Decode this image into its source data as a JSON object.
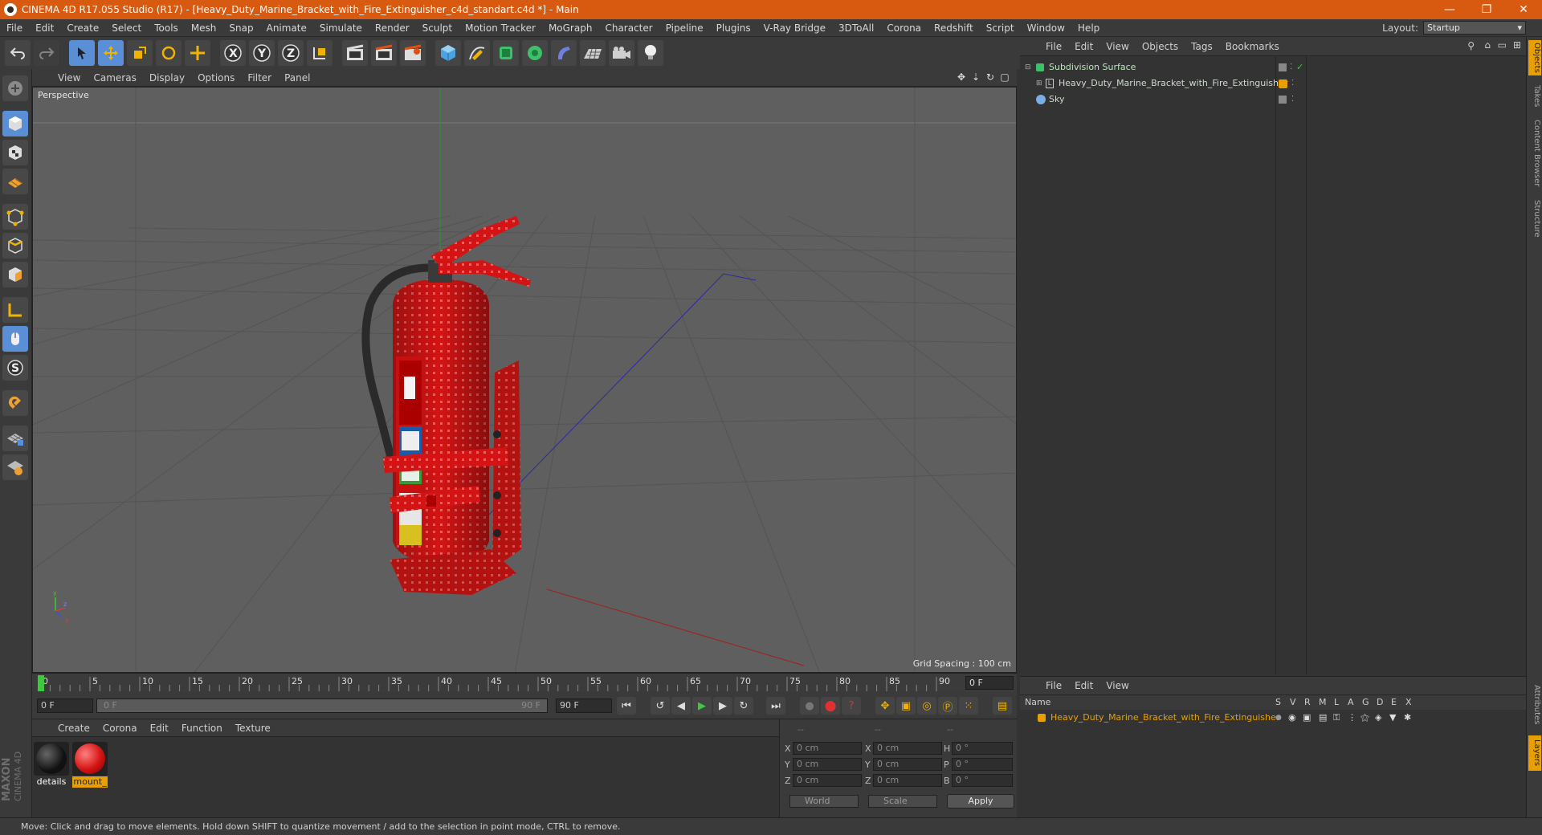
{
  "window": {
    "title": "CINEMA 4D R17.055 Studio (R17) - [Heavy_Duty_Marine_Bracket_with_Fire_Extinguisher_c4d_standart.c4d *] - Main"
  },
  "menubar": {
    "items": [
      "File",
      "Edit",
      "Create",
      "Select",
      "Tools",
      "Mesh",
      "Snap",
      "Animate",
      "Simulate",
      "Render",
      "Sculpt",
      "Motion Tracker",
      "MoGraph",
      "Character",
      "Pipeline",
      "Plugins",
      "V-Ray Bridge",
      "3DToAll",
      "Corona",
      "Redshift",
      "Script",
      "Window",
      "Help"
    ],
    "layout_label": "Layout:",
    "layout_value": "Startup"
  },
  "viewport": {
    "menu": [
      "View",
      "Cameras",
      "Display",
      "Options",
      "Filter",
      "Panel"
    ],
    "label": "Perspective",
    "grid_spacing": "Grid Spacing : 100 cm"
  },
  "timeline": {
    "ticks": [
      "0",
      "5",
      "10",
      "15",
      "20",
      "25",
      "30",
      "35",
      "40",
      "45",
      "50",
      "55",
      "60",
      "65",
      "70",
      "75",
      "80",
      "85",
      "90"
    ],
    "current_frame": "0 F"
  },
  "transport": {
    "start_field": "0 F",
    "range_start": "0 F",
    "range_end": "90 F",
    "end_field": "90 F"
  },
  "material_manager": {
    "menu": [
      "Create",
      "Corona",
      "Edit",
      "Function",
      "Texture"
    ],
    "materials": [
      {
        "name": "details",
        "color": "#1c1c1c"
      },
      {
        "name": "mount_",
        "color": "#d41414"
      }
    ]
  },
  "coordinates": {
    "header": [
      "--",
      "--",
      "--"
    ],
    "rows": [
      {
        "axis1": "X",
        "val1": "0 cm",
        "axis2": "X",
        "val2": "0 cm",
        "axis3": "H",
        "val3": "0 °"
      },
      {
        "axis1": "Y",
        "val1": "0 cm",
        "axis2": "Y",
        "val2": "0 cm",
        "axis3": "P",
        "val3": "0 °"
      },
      {
        "axis1": "Z",
        "val1": "0 cm",
        "axis2": "Z",
        "val2": "0 cm",
        "axis3": "B",
        "val3": "0 °"
      }
    ],
    "world_select": "World",
    "scale_select": "Scale",
    "apply_label": "Apply"
  },
  "object_manager": {
    "menu": [
      "File",
      "Edit",
      "View",
      "Objects",
      "Tags",
      "Bookmarks"
    ],
    "objects": [
      {
        "name": "Subdivision Surface"
      },
      {
        "name": "Heavy_Duty_Marine_Bracket_with_Fire_Extinguisher"
      },
      {
        "name": "Sky"
      }
    ]
  },
  "layer_manager": {
    "menu": [
      "File",
      "Edit",
      "View"
    ],
    "columns": [
      "Name",
      "S",
      "V",
      "R",
      "M",
      "L",
      "A",
      "G",
      "D",
      "E",
      "X"
    ],
    "layers": [
      {
        "name": "Heavy_Duty_Marine_Bracket_with_Fire_Extinguisher",
        "color": "#e8a000"
      }
    ]
  },
  "right_tabs": [
    "Objects",
    "Takes",
    "Content Browser",
    "Structure",
    "Attributes",
    "Layers"
  ],
  "status": {
    "text": "Move: Click and drag to move elements. Hold down SHIFT to quantize movement / add to the selection in point mode, CTRL to remove."
  },
  "branding": {
    "vendor": "MAXON",
    "product": "CINEMA 4D"
  },
  "colors": {
    "titlebar": "#d85a10",
    "accent_orange": "#e8a000",
    "selection_blue": "#5a8fd6",
    "extinguisher_red": "#d41414"
  }
}
